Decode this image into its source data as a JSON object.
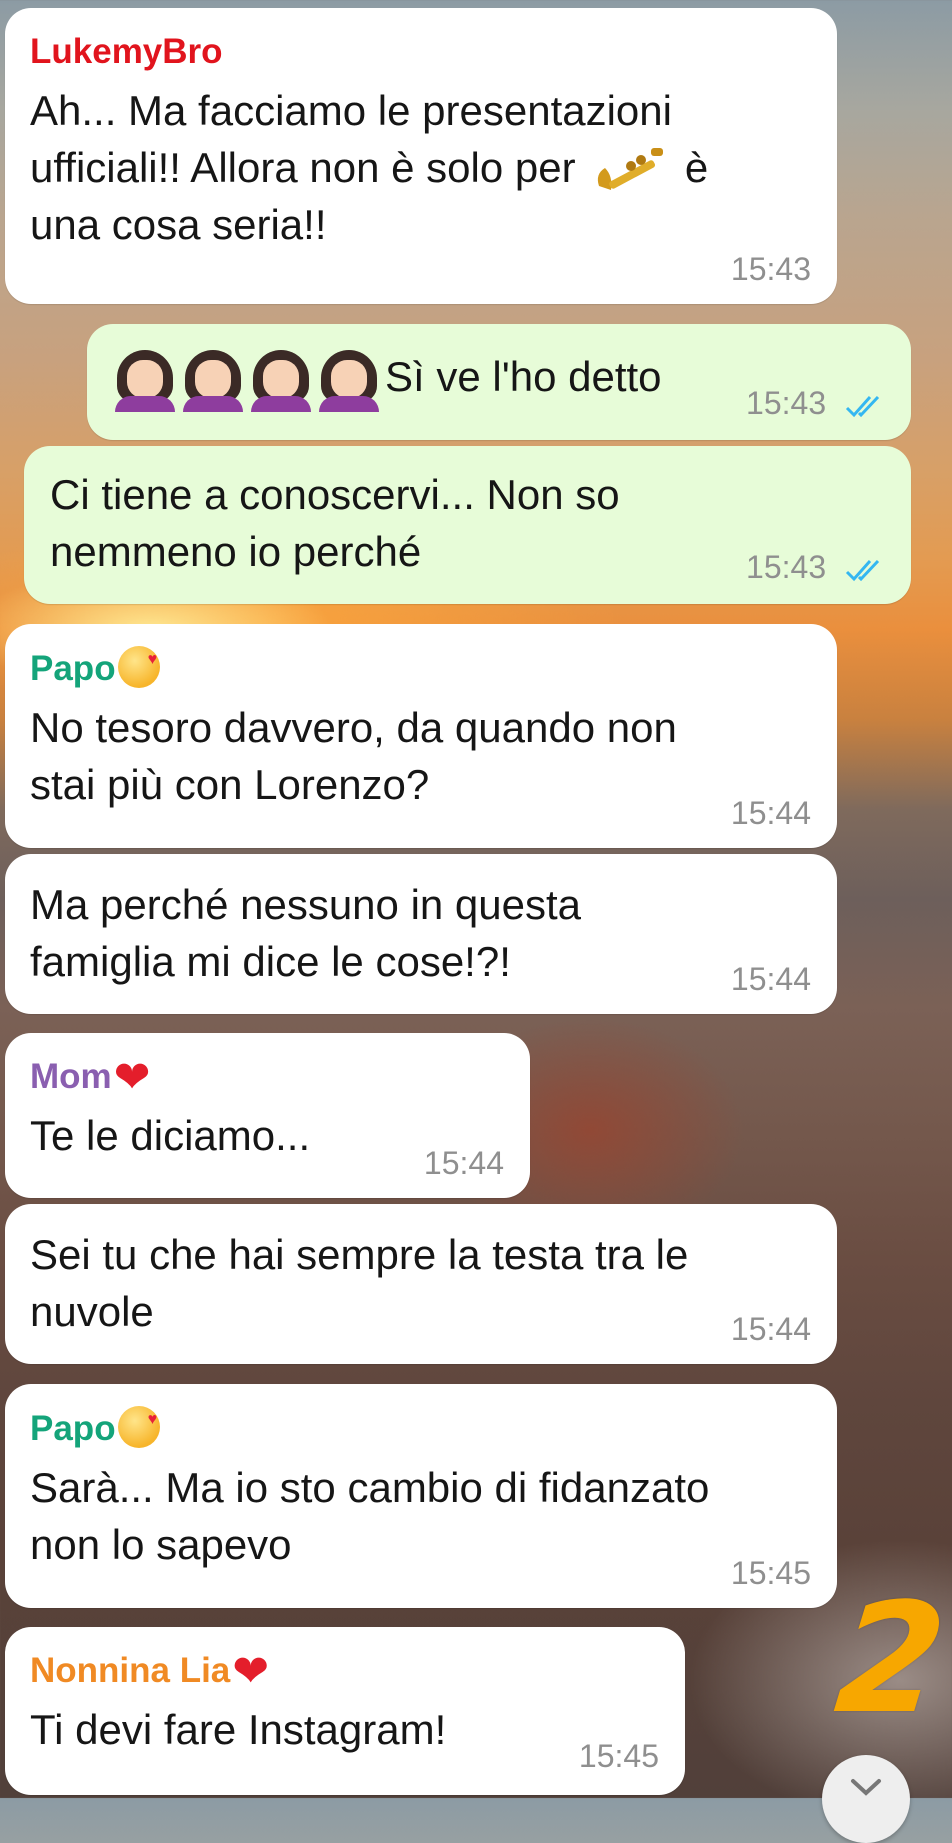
{
  "messages": [
    {
      "sender": "LukemyBro",
      "sender_color": "#e1141d",
      "text_line1": "Ah... Ma facciamo le presentazioni",
      "text_line2a": "ufficiali!! Allora non è solo per",
      "text_line2b": "è",
      "text_line3": "una cosa seria!!",
      "time": "15:43",
      "inline_icon": "trumpet-icon"
    },
    {
      "text": "Sì ve l'ho detto",
      "time": "15:43",
      "prefix_icons": [
        "facepalm-icon",
        "facepalm-icon",
        "facepalm-icon",
        "facepalm-icon"
      ],
      "status": "read"
    },
    {
      "text_line1": "Ci tiene a conoscervi... Non so",
      "text_line2": "nemmeno io perché",
      "time": "15:43",
      "status": "read"
    },
    {
      "sender": "Papo",
      "sender_color": "#14a47a",
      "sender_icon": "smiling-face-with-hearts-icon",
      "text_line1": "No tesoro davvero, da quando non",
      "text_line2": "stai più con Lorenzo?",
      "time": "15:44"
    },
    {
      "text_line1": "Ma perché nessuno in questa",
      "text_line2": "famiglia mi dice le cose!?!",
      "time": "15:44"
    },
    {
      "sender": "Mom",
      "sender_color": "#8a5fb0",
      "sender_icon": "red-heart-icon",
      "text": "Te le diciamo...",
      "time": "15:44"
    },
    {
      "text_line1": "Sei tu che hai sempre la testa tra le",
      "text_line2": "nuvole",
      "time": "15:44"
    },
    {
      "sender": "Papo",
      "sender_color": "#14a47a",
      "sender_icon": "smiling-face-with-hearts-icon",
      "text_line1": "Sarà... Ma io sto cambio di fidanzato",
      "text_line2": "non lo sapevo",
      "time": "15:45"
    },
    {
      "sender": "Nonnina Lia",
      "sender_color": "#f08a24",
      "sender_icon": "red-heart-icon",
      "text": "Ti devi fare Instagram!",
      "time": "15:45"
    }
  ],
  "overlay": {
    "page_number": "2"
  },
  "colors": {
    "incoming_bubble": "#ffffff",
    "outgoing_bubble": "#e7fcd8",
    "read_ticks": "#34b7f1"
  }
}
